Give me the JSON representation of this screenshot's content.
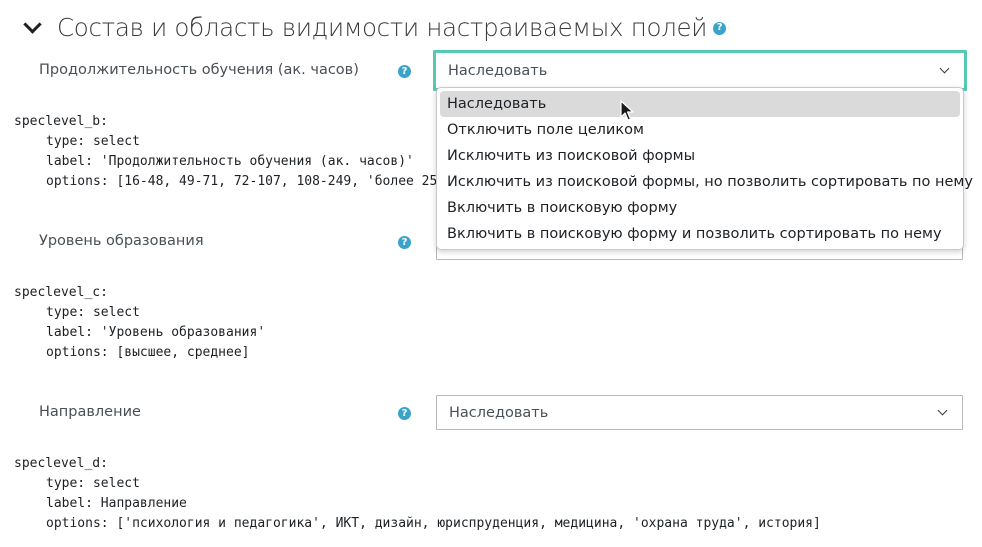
{
  "section": {
    "title": "Состав и область видимости настраиваемых полей",
    "help_icon": "question-circle-icon"
  },
  "fields": [
    {
      "label": "Продолжительность обучения (ак. часов)",
      "select_value": "Наследовать",
      "code": {
        "key": "speclevel_b:",
        "type": "type: select",
        "label": "label: 'Продолжительность обучения (ак. часов)'",
        "options": "options: [16-48, 49-71, 72-107, 108-249, 'более 25"
      }
    },
    {
      "label": "Уровень образования",
      "select_value": "",
      "code": {
        "key": "speclevel_c:",
        "type": "type: select",
        "label": "label: 'Уровень образования'",
        "options": "options: [высшее, среднее]"
      }
    },
    {
      "label": "Направление",
      "select_value": "Наследовать",
      "code": {
        "key": "speclevel_d:",
        "type": "type: select",
        "label": "label: Направление",
        "options": "options: ['психология и педагогика', ИКТ, дизайн, юриспруденция, медицина, 'охрана труда', история]"
      }
    }
  ],
  "dropdown": {
    "options": [
      "Наследовать",
      "Отключить поле целиком",
      "Исключить из поисковой формы",
      "Исключить из поисковой формы, но позволить сортировать по нему",
      "Включить в поисковую форму",
      "Включить в поисковую форму и позволить сортировать по нему"
    ],
    "hovered": "Наследовать"
  },
  "colors": {
    "focus_border": "#55c9b1",
    "help_icon": "#3aa3c9",
    "hover_bg": "#dadada"
  }
}
